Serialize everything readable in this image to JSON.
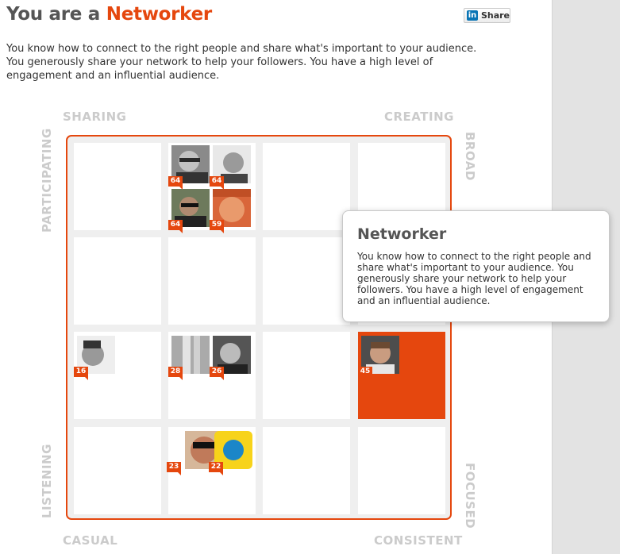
{
  "header": {
    "title_prefix": "You are a",
    "title_type": "Networker",
    "share_button": {
      "logo": "in",
      "label": "Share"
    },
    "description": "You know how to connect to the right people and share what's important to your audience. You generously share your network to help your followers. You have a high level of engagement and an influential audience."
  },
  "axes": {
    "top_left": "SHARING",
    "top_right": "CREATING",
    "bottom_left": "CASUAL",
    "bottom_right": "CONSISTENT",
    "left_top": "PARTICIPATING",
    "left_bottom": "LISTENING",
    "right_top": "BROAD",
    "right_bottom": "FOCUSED"
  },
  "matrix": {
    "highlighted_cell": "row3-col4",
    "scores": {
      "c12_a": "64",
      "c12_b": "64",
      "c12_c": "64",
      "c12_d": "59",
      "c31_a": "16",
      "c32_a": "28",
      "c32_b": "26",
      "c34_a": "45",
      "c42_a": "23",
      "c42_b": "22"
    }
  },
  "tooltip": {
    "title": "Networker",
    "text": "You know how to connect to the right people and share what's important to your audience. You generously share your network to help your followers. You have a high level of engagement and an influential audience."
  },
  "colors": {
    "accent": "#e5470e",
    "axis_label": "#cbcbcb"
  }
}
